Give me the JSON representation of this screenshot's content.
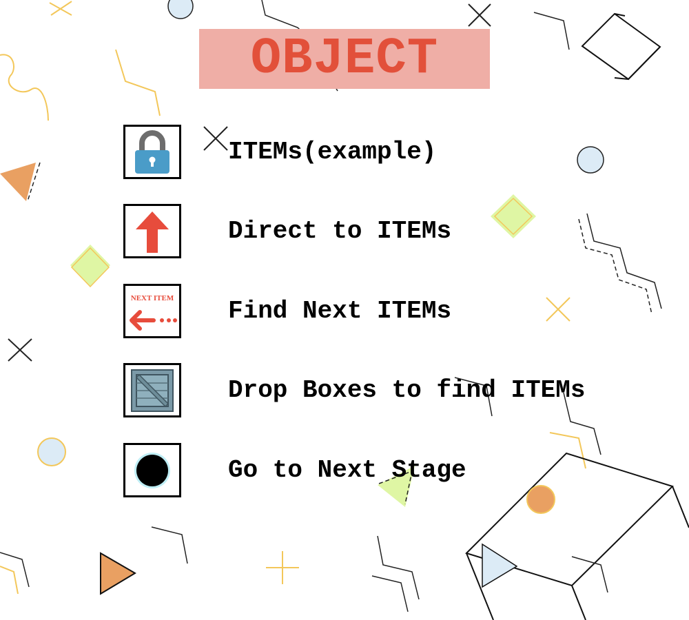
{
  "title": "OBJECT",
  "colors": {
    "banner_bg": "#efaea6",
    "title_text": "#e2503a",
    "accent_red": "#e74c3c",
    "lock_blue": "#4a9cc8",
    "crate": "#7b9aa8"
  },
  "legend": [
    {
      "icon": "padlock-icon",
      "label": "ITEMs(example)"
    },
    {
      "icon": "up-arrow-icon",
      "label": "Direct to ITEMs"
    },
    {
      "icon": "next-item-arrow-icon",
      "label": "Find Next ITEMs",
      "icon_text": "NEXT ITEM"
    },
    {
      "icon": "wooden-crate-icon",
      "label": "Drop Boxes to find ITEMs"
    },
    {
      "icon": "black-hole-icon",
      "label": "Go to Next Stage"
    }
  ]
}
